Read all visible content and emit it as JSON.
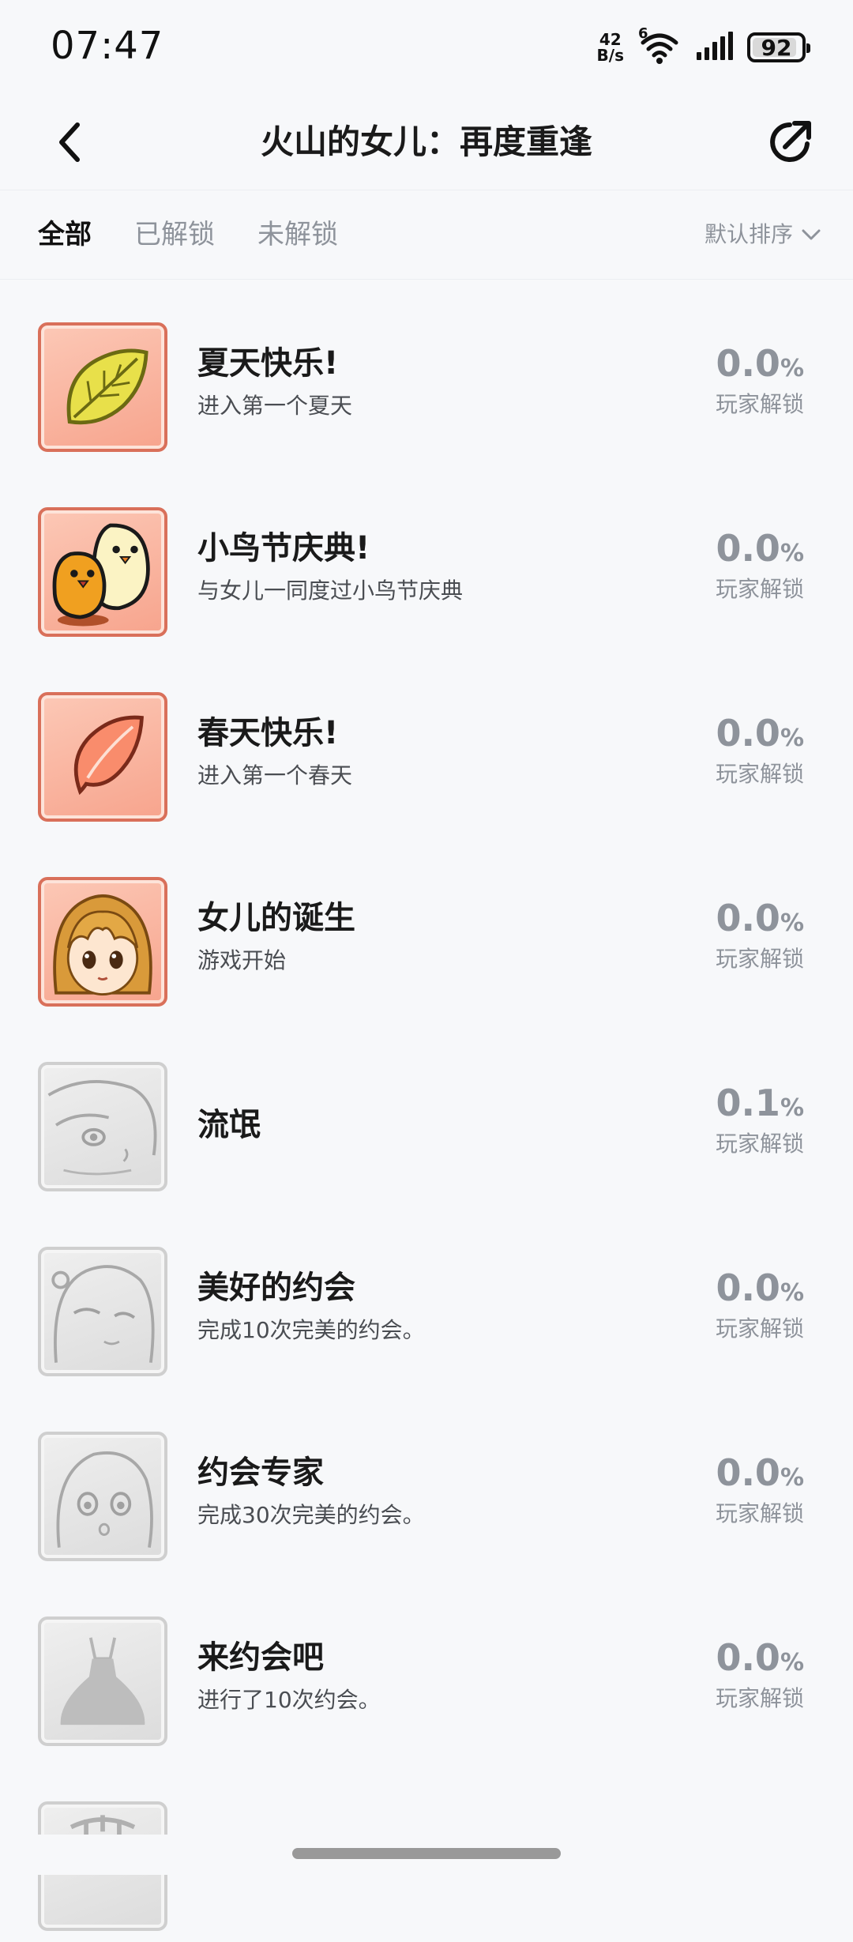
{
  "status_bar": {
    "time": "07:47",
    "net_speed_value": "42",
    "net_speed_unit": "B/s",
    "wifi_label": "6",
    "battery": "92",
    "battery_level": 0.92
  },
  "nav": {
    "title": "火山的女儿：再度重逢",
    "back_icon": "chevron-left-icon",
    "share_icon": "share-icon"
  },
  "tabs": {
    "items": [
      {
        "label": "全部",
        "active": true
      },
      {
        "label": "已解锁",
        "active": false
      },
      {
        "label": "未解锁",
        "active": false
      }
    ],
    "sort_label": "默认排序"
  },
  "achievements": [
    {
      "title": "夏天快乐!",
      "desc": "进入第一个夏天",
      "pct": "0.0",
      "unit": "%",
      "label": "玩家解锁",
      "icon": "leaf-icon",
      "unlocked": true
    },
    {
      "title": "小鸟节庆典!",
      "desc": "与女儿一同度过小鸟节庆典",
      "pct": "0.0",
      "unit": "%",
      "label": "玩家解锁",
      "icon": "chicks-icon",
      "unlocked": true
    },
    {
      "title": "春天快乐!",
      "desc": "进入第一个春天",
      "pct": "0.0",
      "unit": "%",
      "label": "玩家解锁",
      "icon": "petal-icon",
      "unlocked": true
    },
    {
      "title": "女儿的诞生",
      "desc": "游戏开始",
      "pct": "0.0",
      "unit": "%",
      "label": "玩家解锁",
      "icon": "girl-portrait-icon",
      "unlocked": true
    },
    {
      "title": "流氓",
      "desc": "",
      "pct": "0.1",
      "unit": "%",
      "label": "玩家解锁",
      "icon": "girl-face-icon",
      "unlocked": false
    },
    {
      "title": "美好的约会",
      "desc": "完成10次完美的约会。",
      "pct": "0.0",
      "unit": "%",
      "label": "玩家解锁",
      "icon": "girl-wink-icon",
      "unlocked": false
    },
    {
      "title": "约会专家",
      "desc": "完成30次完美的约会。",
      "pct": "0.0",
      "unit": "%",
      "label": "玩家解锁",
      "icon": "girl-surprised-icon",
      "unlocked": false
    },
    {
      "title": "来约会吧",
      "desc": "进行了10次约会。",
      "pct": "0.0",
      "unit": "%",
      "label": "玩家解锁",
      "icon": "dress-icon",
      "unlocked": false
    }
  ]
}
